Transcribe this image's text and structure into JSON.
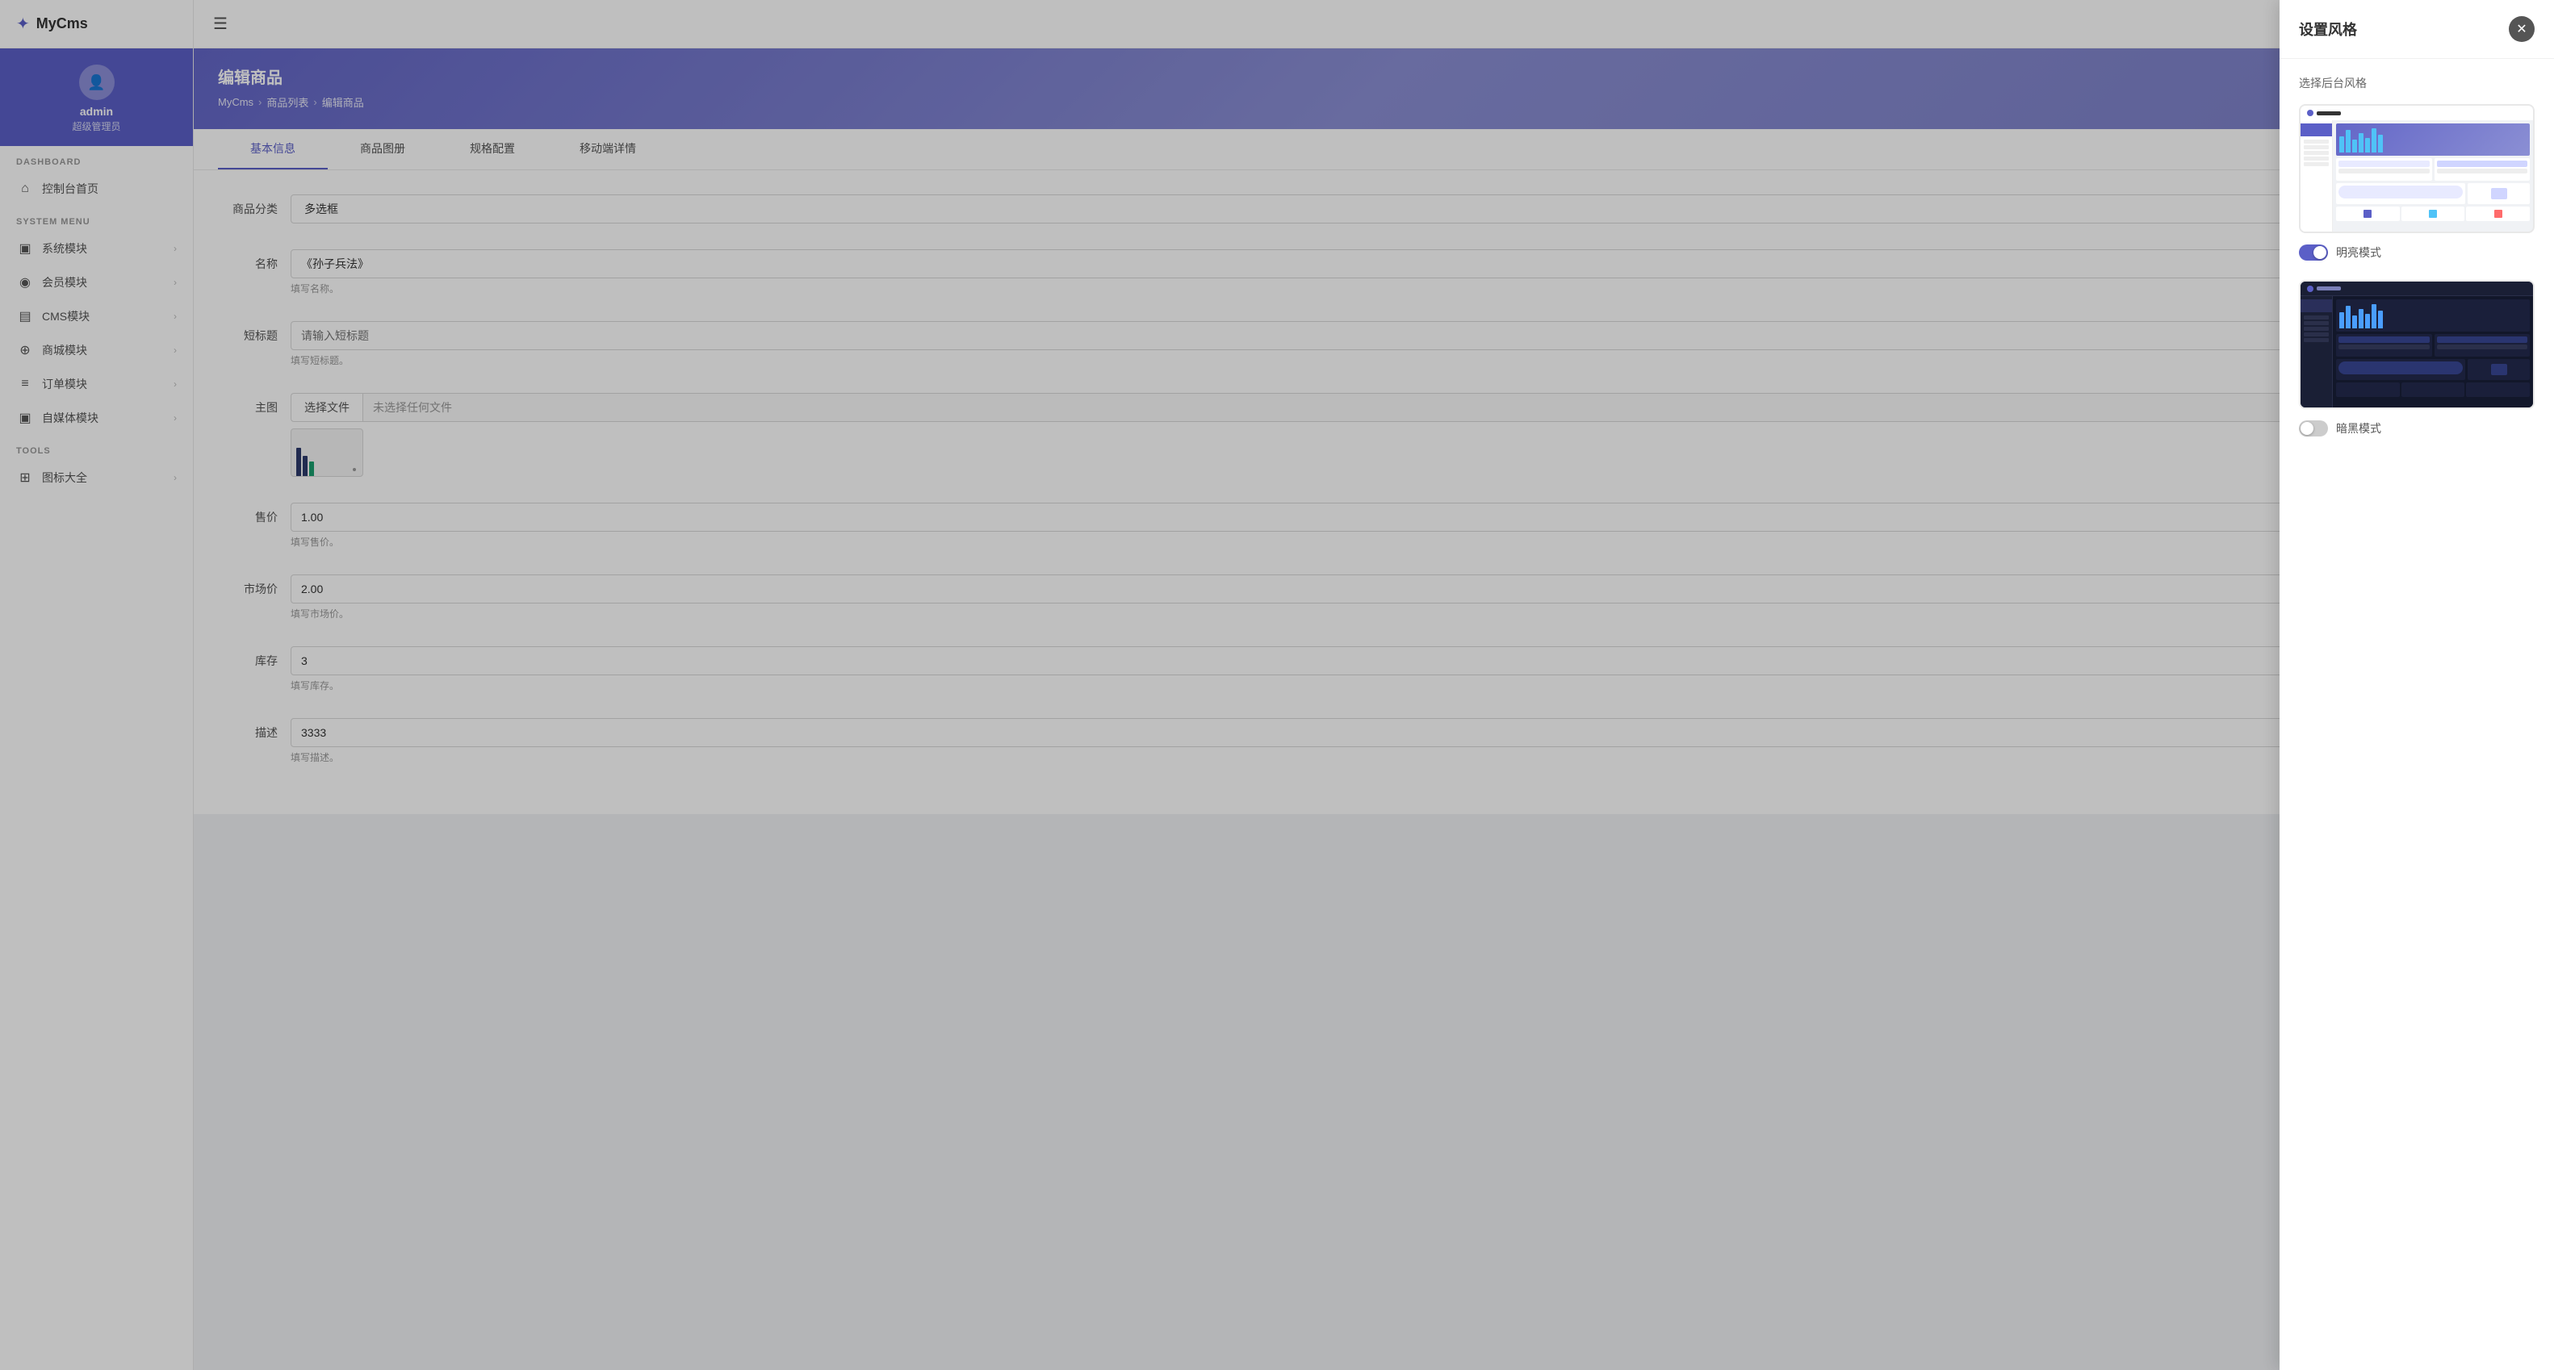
{
  "app": {
    "logo_icon": "✦",
    "logo_text": "MyCms"
  },
  "sidebar": {
    "user": {
      "name": "admin",
      "role": "超级管理员"
    },
    "sections": [
      {
        "label": "DASHBOARD",
        "items": [
          {
            "id": "dashboard",
            "icon": "⌂",
            "label": "控制台首页",
            "arrow": false
          }
        ]
      },
      {
        "label": "SYSTEM MENU",
        "items": [
          {
            "id": "system",
            "icon": "▣",
            "label": "系统模块",
            "arrow": true
          },
          {
            "id": "member",
            "icon": "◉",
            "label": "会员模块",
            "arrow": true
          },
          {
            "id": "cms",
            "icon": "▤",
            "label": "CMS模块",
            "arrow": true
          },
          {
            "id": "shop",
            "icon": "⊕",
            "label": "商城模块",
            "arrow": true
          },
          {
            "id": "order",
            "icon": "≡",
            "label": "订单模块",
            "arrow": true
          },
          {
            "id": "media",
            "icon": "▣",
            "label": "自媒体模块",
            "arrow": true
          }
        ]
      },
      {
        "label": "TOOLS",
        "items": [
          {
            "id": "icons",
            "icon": "⊞",
            "label": "图标大全",
            "arrow": true
          }
        ]
      }
    ]
  },
  "topbar": {
    "menu_icon": "☰"
  },
  "page_header": {
    "title": "编辑商品",
    "breadcrumb": [
      "MyCms",
      "商品列表",
      "编辑商品"
    ]
  },
  "tabs": [
    {
      "id": "basic",
      "label": "基本信息",
      "active": true
    },
    {
      "id": "gallery",
      "label": "商品图册",
      "active": false
    },
    {
      "id": "spec",
      "label": "规格配置",
      "active": false
    },
    {
      "id": "mobile",
      "label": "移动端详情",
      "active": false
    }
  ],
  "form": {
    "fields": [
      {
        "id": "category",
        "label": "商品分类",
        "type": "select",
        "value": "多选框",
        "hint": ""
      },
      {
        "id": "name",
        "label": "名称",
        "type": "text",
        "value": "《孙子兵法》",
        "hint": "填写名称。"
      },
      {
        "id": "subtitle",
        "label": "短标题",
        "type": "text",
        "value": "",
        "placeholder": "请输入短标题",
        "hint": "填写短标题。"
      },
      {
        "id": "main_image",
        "label": "主图",
        "type": "file",
        "btn_label": "选择文件",
        "filename": "未选择任何文件"
      },
      {
        "id": "price",
        "label": "售价",
        "type": "text",
        "value": "1.00",
        "hint": "填写售价。"
      },
      {
        "id": "market_price",
        "label": "市场价",
        "type": "text",
        "value": "2.00",
        "hint": "填写市场价。"
      },
      {
        "id": "stock",
        "label": "库存",
        "type": "text",
        "value": "3",
        "hint": "填写库存。"
      },
      {
        "id": "description",
        "label": "描述",
        "type": "text",
        "value": "3333",
        "hint": "填写描述。"
      }
    ]
  },
  "settings_panel": {
    "title": "设置风格",
    "close_icon": "✕",
    "section_title": "选择后台风格",
    "themes": [
      {
        "id": "light",
        "label": "明亮模式",
        "active": true
      },
      {
        "id": "dark",
        "label": "暗黑模式",
        "active": false
      }
    ]
  }
}
